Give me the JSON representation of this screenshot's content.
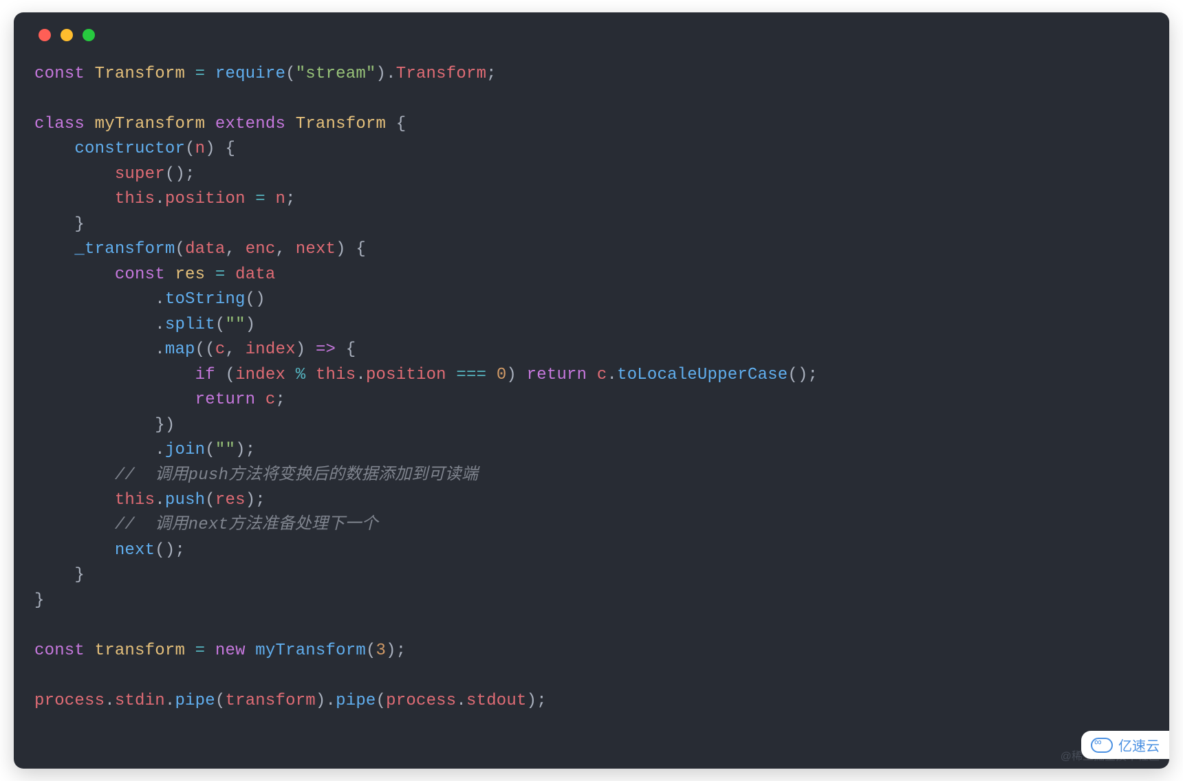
{
  "colors": {
    "background": "#282c34",
    "foreground": "#abb2bf",
    "keyword": "#c678dd",
    "class": "#e5c07b",
    "variable": "#e06c75",
    "function": "#61afef",
    "string": "#98c379",
    "number": "#d19a66",
    "operator": "#56b6c2",
    "comment": "#7f848e",
    "traffic_red": "#ff5f56",
    "traffic_yellow": "#ffbd2e",
    "traffic_green": "#27c93f"
  },
  "code": {
    "lines": [
      [
        [
          "kw",
          "const"
        ],
        [
          "pun",
          " "
        ],
        [
          "cls",
          "Transform"
        ],
        [
          "pun",
          " "
        ],
        [
          "op",
          "="
        ],
        [
          "pun",
          " "
        ],
        [
          "fn",
          "require"
        ],
        [
          "pun",
          "("
        ],
        [
          "str",
          "\"stream\""
        ],
        [
          "pun",
          ")."
        ],
        [
          "var",
          "Transform"
        ],
        [
          "pun",
          ";"
        ]
      ],
      [
        [
          "pun",
          ""
        ]
      ],
      [
        [
          "kw",
          "class"
        ],
        [
          "pun",
          " "
        ],
        [
          "cls",
          "myTransform"
        ],
        [
          "pun",
          " "
        ],
        [
          "kw",
          "extends"
        ],
        [
          "pun",
          " "
        ],
        [
          "cls",
          "Transform"
        ],
        [
          "pun",
          " {"
        ]
      ],
      [
        [
          "pun",
          "    "
        ],
        [
          "fn",
          "constructor"
        ],
        [
          "pun",
          "("
        ],
        [
          "var",
          "n"
        ],
        [
          "pun",
          ") {"
        ]
      ],
      [
        [
          "pun",
          "        "
        ],
        [
          "var",
          "super"
        ],
        [
          "pun",
          "();"
        ]
      ],
      [
        [
          "pun",
          "        "
        ],
        [
          "var",
          "this"
        ],
        [
          "pun",
          "."
        ],
        [
          "var",
          "position"
        ],
        [
          "pun",
          " "
        ],
        [
          "op",
          "="
        ],
        [
          "pun",
          " "
        ],
        [
          "var",
          "n"
        ],
        [
          "pun",
          ";"
        ]
      ],
      [
        [
          "pun",
          "    }"
        ]
      ],
      [
        [
          "pun",
          "    "
        ],
        [
          "fn",
          "_transform"
        ],
        [
          "pun",
          "("
        ],
        [
          "var",
          "data"
        ],
        [
          "pun",
          ", "
        ],
        [
          "var",
          "enc"
        ],
        [
          "pun",
          ", "
        ],
        [
          "var",
          "next"
        ],
        [
          "pun",
          ") {"
        ]
      ],
      [
        [
          "pun",
          "        "
        ],
        [
          "kw",
          "const"
        ],
        [
          "pun",
          " "
        ],
        [
          "cls",
          "res"
        ],
        [
          "pun",
          " "
        ],
        [
          "op",
          "="
        ],
        [
          "pun",
          " "
        ],
        [
          "var",
          "data"
        ]
      ],
      [
        [
          "pun",
          "            ."
        ],
        [
          "fn",
          "toString"
        ],
        [
          "pun",
          "()"
        ]
      ],
      [
        [
          "pun",
          "            ."
        ],
        [
          "fn",
          "split"
        ],
        [
          "pun",
          "("
        ],
        [
          "str",
          "\"\""
        ],
        [
          "pun",
          ")"
        ]
      ],
      [
        [
          "pun",
          "            ."
        ],
        [
          "fn",
          "map"
        ],
        [
          "pun",
          "(("
        ],
        [
          "var",
          "c"
        ],
        [
          "pun",
          ", "
        ],
        [
          "var",
          "index"
        ],
        [
          "pun",
          ") "
        ],
        [
          "kw",
          "=>"
        ],
        [
          "pun",
          " {"
        ]
      ],
      [
        [
          "pun",
          "                "
        ],
        [
          "kw",
          "if"
        ],
        [
          "pun",
          " ("
        ],
        [
          "var",
          "index"
        ],
        [
          "pun",
          " "
        ],
        [
          "op",
          "%"
        ],
        [
          "pun",
          " "
        ],
        [
          "var",
          "this"
        ],
        [
          "pun",
          "."
        ],
        [
          "var",
          "position"
        ],
        [
          "pun",
          " "
        ],
        [
          "op",
          "==="
        ],
        [
          "pun",
          " "
        ],
        [
          "num",
          "0"
        ],
        [
          "pun",
          ") "
        ],
        [
          "kw",
          "return"
        ],
        [
          "pun",
          " "
        ],
        [
          "var",
          "c"
        ],
        [
          "pun",
          "."
        ],
        [
          "fn",
          "toLocaleUpperCase"
        ],
        [
          "pun",
          "();"
        ]
      ],
      [
        [
          "pun",
          "                "
        ],
        [
          "kw",
          "return"
        ],
        [
          "pun",
          " "
        ],
        [
          "var",
          "c"
        ],
        [
          "pun",
          ";"
        ]
      ],
      [
        [
          "pun",
          "            })"
        ]
      ],
      [
        [
          "pun",
          "            ."
        ],
        [
          "fn",
          "join"
        ],
        [
          "pun",
          "("
        ],
        [
          "str",
          "\"\""
        ],
        [
          "pun",
          ");"
        ]
      ],
      [
        [
          "pun",
          "        "
        ],
        [
          "cmt",
          "//  调用push方法将变换后的数据添加到可读端"
        ]
      ],
      [
        [
          "pun",
          "        "
        ],
        [
          "var",
          "this"
        ],
        [
          "pun",
          "."
        ],
        [
          "fn",
          "push"
        ],
        [
          "pun",
          "("
        ],
        [
          "var",
          "res"
        ],
        [
          "pun",
          ");"
        ]
      ],
      [
        [
          "pun",
          "        "
        ],
        [
          "cmt",
          "//  调用next方法准备处理下一个"
        ]
      ],
      [
        [
          "pun",
          "        "
        ],
        [
          "fn",
          "next"
        ],
        [
          "pun",
          "();"
        ]
      ],
      [
        [
          "pun",
          "    }"
        ]
      ],
      [
        [
          "pun",
          "}"
        ]
      ],
      [
        [
          "pun",
          ""
        ]
      ],
      [
        [
          "kw",
          "const"
        ],
        [
          "pun",
          " "
        ],
        [
          "cls",
          "transform"
        ],
        [
          "pun",
          " "
        ],
        [
          "op",
          "="
        ],
        [
          "pun",
          " "
        ],
        [
          "kw",
          "new"
        ],
        [
          "pun",
          " "
        ],
        [
          "fn",
          "myTransform"
        ],
        [
          "pun",
          "("
        ],
        [
          "num",
          "3"
        ],
        [
          "pun",
          ");"
        ]
      ],
      [
        [
          "pun",
          ""
        ]
      ],
      [
        [
          "var",
          "process"
        ],
        [
          "pun",
          "."
        ],
        [
          "var",
          "stdin"
        ],
        [
          "pun",
          "."
        ],
        [
          "fn",
          "pipe"
        ],
        [
          "pun",
          "("
        ],
        [
          "var",
          "transform"
        ],
        [
          "pun",
          ")."
        ],
        [
          "fn",
          "pipe"
        ],
        [
          "pun",
          "("
        ],
        [
          "var",
          "process"
        ],
        [
          "pun",
          "."
        ],
        [
          "var",
          "stdout"
        ],
        [
          "pun",
          ");"
        ]
      ]
    ]
  },
  "watermarks": {
    "juejin": "@稀土掘金技术社区",
    "yisu": "亿速云"
  }
}
